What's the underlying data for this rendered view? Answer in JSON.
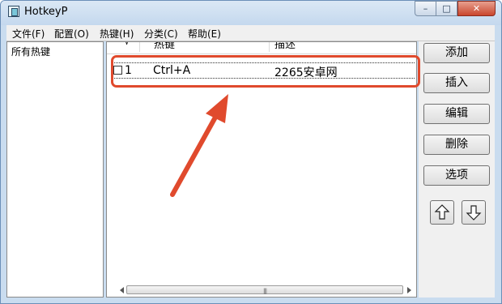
{
  "window": {
    "title": "HotkeyP"
  },
  "controls": {
    "minimize": "–",
    "maximize": "□",
    "close": "✕"
  },
  "menu": [
    {
      "label": "文件(F)"
    },
    {
      "label": "配置(O)"
    },
    {
      "label": "热键(H)"
    },
    {
      "label": "分类(C)"
    },
    {
      "label": "帮助(E)"
    }
  ],
  "categories": {
    "items": [
      {
        "label": "所有热键"
      }
    ]
  },
  "list": {
    "columns": [
      {
        "label": "√"
      },
      {
        "label": "热键"
      },
      {
        "label": "描述"
      }
    ],
    "rows": [
      {
        "index": "1",
        "hotkey": "Ctrl+A",
        "description": "2265安卓网"
      }
    ]
  },
  "buttons": {
    "add": "添加",
    "insert": "插入",
    "edit": "编辑",
    "delete": "删除",
    "options": "选项"
  },
  "icons": {
    "move_up": "arrow-up-icon",
    "move_down": "arrow-down-icon",
    "app": "hotkeyp-app-icon"
  },
  "colors": {
    "annotation": "#e04a2d",
    "titlebar": "#c9dcef"
  }
}
